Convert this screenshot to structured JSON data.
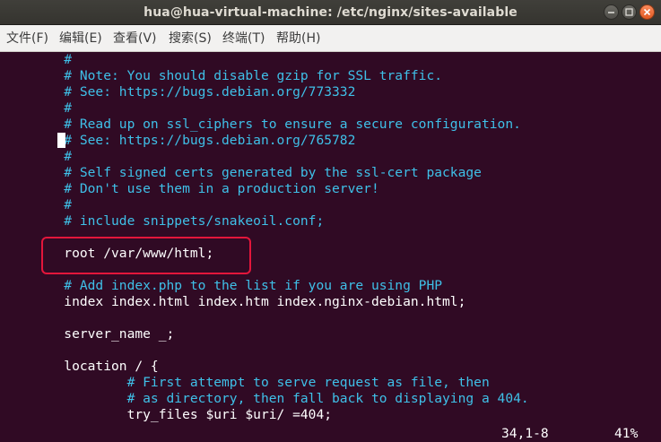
{
  "window": {
    "title": "hua@hua-virtual-machine: /etc/nginx/sites-available"
  },
  "menu": {
    "items": [
      {
        "label": "文件(F)"
      },
      {
        "label": "编辑(E)"
      },
      {
        "label": "查看(V)"
      },
      {
        "label": "搜索(S)"
      },
      {
        "label": "终端(T)"
      },
      {
        "label": "帮助(H)"
      }
    ]
  },
  "editor": {
    "lines": [
      {
        "text": "        #",
        "kind": "comment"
      },
      {
        "text": "        # Note: You should disable gzip for SSL traffic.",
        "kind": "comment"
      },
      {
        "text": "        # See: https://bugs.debian.org/773332",
        "kind": "comment"
      },
      {
        "text": "        #",
        "kind": "comment"
      },
      {
        "text": "        # Read up on ssl_ciphers to ensure a secure configuration.",
        "kind": "comment"
      },
      {
        "text": "        # See: https://bugs.debian.org/765782",
        "kind": "comment"
      },
      {
        "text": "        #",
        "kind": "comment"
      },
      {
        "text": "        # Self signed certs generated by the ssl-cert package",
        "kind": "comment"
      },
      {
        "text": "        # Don't use them in a production server!",
        "kind": "comment"
      },
      {
        "text": "        #",
        "kind": "comment"
      },
      {
        "text": "        # include snippets/snakeoil.conf;",
        "kind": "comment"
      },
      {
        "text": "",
        "kind": "code"
      },
      {
        "text": "        root /var/www/html;",
        "kind": "code"
      },
      {
        "text": "",
        "kind": "code"
      },
      {
        "text": "        # Add index.php to the list if you are using PHP",
        "kind": "comment"
      },
      {
        "text": "        index index.html index.htm index.nginx-debian.html;",
        "kind": "code"
      },
      {
        "text": "",
        "kind": "code"
      },
      {
        "text": "        server_name _;",
        "kind": "code"
      },
      {
        "text": "",
        "kind": "code"
      },
      {
        "text": "        location / {",
        "kind": "code"
      },
      {
        "text": "                # First attempt to serve request as file, then",
        "kind": "comment"
      },
      {
        "text": "                # as directory, then fall back to displaying a 404.",
        "kind": "comment"
      },
      {
        "text": "                try_files $uri $uri/ =404;",
        "kind": "code"
      }
    ],
    "status": {
      "position": "34,1-8",
      "percent": "41%"
    }
  },
  "colors": {
    "terminal_bg": "#300a24",
    "comment": "#3fc0e8",
    "code": "#ffffff",
    "highlight_border": "#e3163b"
  }
}
